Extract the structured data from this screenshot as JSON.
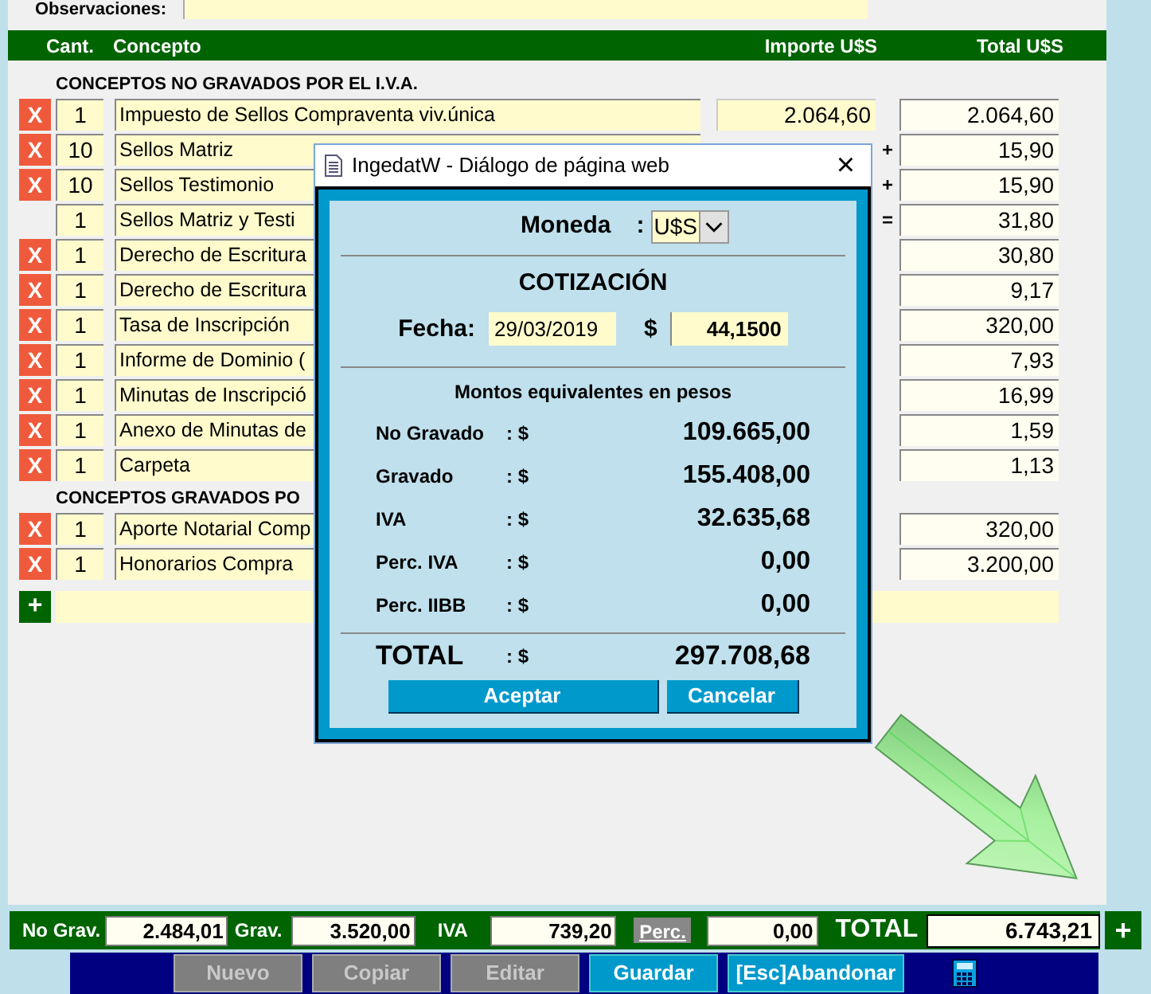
{
  "observaciones": {
    "label": "Observaciones:"
  },
  "columns": [
    "Cant.",
    "Concepto",
    "Importe U$S",
    "Total U$S"
  ],
  "sections": [
    {
      "title": "CONCEPTOS NO GRAVADOS POR EL I.V.A.",
      "rows": [
        {
          "remove": "X",
          "qty": "1",
          "concept": "Impuesto de Sellos Compraventa viv.única",
          "importe": "2.064,60",
          "total": "2.064,60"
        },
        {
          "remove": "X",
          "qty": "10",
          "concept": "Sellos Matriz",
          "operator": "+",
          "total": "15,90"
        },
        {
          "remove": "X",
          "qty": "10",
          "concept": "Sellos Testimonio",
          "operator": "+",
          "total": "15,90"
        },
        {
          "qty": "1",
          "concept": "Sellos Matriz y Testi",
          "operator": "=",
          "total": "31,80"
        },
        {
          "remove": "X",
          "qty": "1",
          "concept": "Derecho de Escritura",
          "total": "30,80"
        },
        {
          "remove": "X",
          "qty": "1",
          "concept": "Derecho de Escritura",
          "total": "9,17"
        },
        {
          "remove": "X",
          "qty": "1",
          "concept": "Tasa de Inscripción",
          "total": "320,00"
        },
        {
          "remove": "X",
          "qty": "1",
          "concept": "Informe de Dominio (",
          "total": "7,93"
        },
        {
          "remove": "X",
          "qty": "1",
          "concept": "Minutas de Inscripció",
          "total": "16,99"
        },
        {
          "remove": "X",
          "qty": "1",
          "concept": "Anexo de Minutas de",
          "total": "1,59"
        },
        {
          "remove": "X",
          "qty": "1",
          "concept": "Carpeta",
          "total": "1,13"
        }
      ]
    },
    {
      "title": "CONCEPTOS GRAVADOS PO",
      "rows": [
        {
          "remove": "X",
          "qty": "1",
          "concept": "Aporte Notarial Comp",
          "total": "320,00"
        },
        {
          "remove": "X",
          "qty": "1",
          "concept": "Honorarios Compra",
          "total": "3.200,00"
        }
      ]
    }
  ],
  "add_button": "+",
  "dialog": {
    "title": "IngedatW - Diálogo de página web",
    "close": "×",
    "moneda_label": "Moneda",
    "moneda_colon": ":",
    "currency": "U$S",
    "cotizacion": "COTIZACIÓN",
    "fecha_label": "Fecha:",
    "fecha": "29/03/2019",
    "rate_symbol": "$",
    "rate": "44,1500",
    "subtitle": "Montos equivalentes en pesos",
    "amounts": [
      {
        "label": "No Gravado",
        "sep": ": $",
        "value": "109.665,00"
      },
      {
        "label": "Gravado",
        "sep": ": $",
        "value": "155.408,00"
      },
      {
        "label": "IVA",
        "sep": ": $",
        "value": "32.635,68"
      },
      {
        "label": "Perc. IVA",
        "sep": ": $",
        "value": "0,00"
      },
      {
        "label": "Perc. IIBB",
        "sep": ": $",
        "value": "0,00"
      }
    ],
    "total": {
      "label": "TOTAL",
      "sep": ": $",
      "value": "297.708,68"
    },
    "buttons": [
      "Aceptar",
      "Cancelar"
    ]
  },
  "footer": {
    "no_grav_label": "No Grav.",
    "no_grav": "2.484,01",
    "grav_label": "Grav.",
    "grav": "3.520,00",
    "iva_label": "IVA",
    "iva": "739,20",
    "perc_button": "Perc.",
    "perc": "0,00",
    "total_label": "TOTAL",
    "total": "6.743,21",
    "add_button": "+"
  },
  "actions": [
    {
      "label": "Nuevo",
      "disabled": true
    },
    {
      "label": "Copiar",
      "disabled": true
    },
    {
      "label": "Editar",
      "disabled": true
    },
    {
      "label": "Guardar",
      "disabled": false
    },
    {
      "label": "[Esc]Abandonar",
      "disabled": false
    }
  ]
}
